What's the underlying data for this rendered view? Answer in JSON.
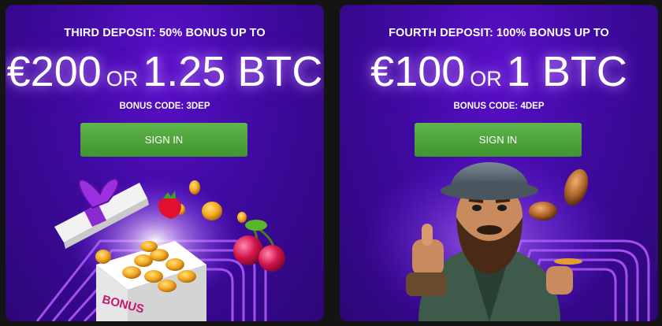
{
  "promos": [
    {
      "headline": "THIRD DEPOSIT: 50% BONUS UP TO",
      "amount_fiat": "€200",
      "or_text": "OR",
      "amount_btc": "1.25 BTC",
      "bonus_code": "BONUS CODE: 3DEP",
      "button_label": "SIGN IN",
      "box_text": "BONUS"
    },
    {
      "headline": "FOURTH DEPOSIT: 100% BONUS UP TO",
      "amount_fiat": "€100",
      "or_text": "OR",
      "amount_btc": "1 BTC",
      "bonus_code": "BONUS CODE: 4DEP",
      "button_label": "SIGN IN"
    }
  ],
  "colors": {
    "page_bg": "#141414",
    "card_purple": "#3f0aa0",
    "button_green": "#4ca43a",
    "text_white": "#ffffff"
  }
}
